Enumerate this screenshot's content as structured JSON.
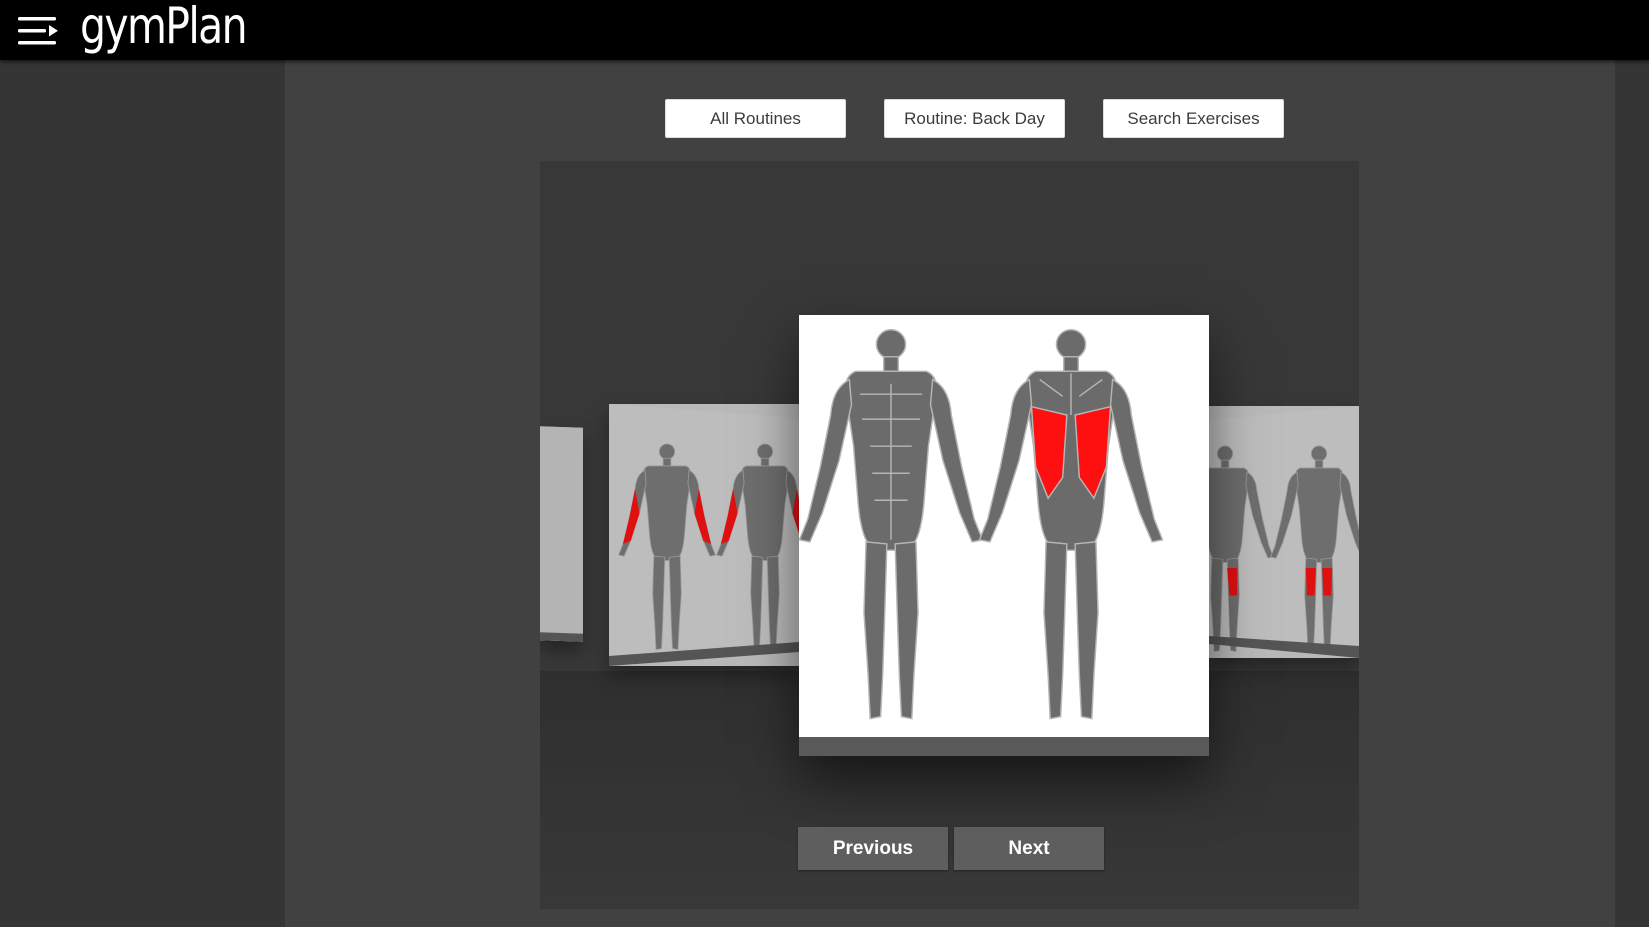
{
  "header": {
    "brand": "gymPlan",
    "menu_icon": "menu-hamburger-icon"
  },
  "toolbar": {
    "all_routines_label": "All Routines",
    "routine_label": "Routine: Back Day",
    "search_label": "Search Exercises"
  },
  "carousel": {
    "previous_label": "Previous",
    "next_label": "Next",
    "slides": [
      {
        "highlight": "back-left-edge"
      },
      {
        "highlight": "forearms"
      },
      {
        "highlight": "lats"
      },
      {
        "highlight": "hamstrings"
      }
    ],
    "active_index": 2
  },
  "colors": {
    "topbar": "#000000",
    "background": "#353535",
    "panel": "#414141",
    "stage": "#383838",
    "muscle": "#6b6b6b",
    "highlight": "#ff1010",
    "nav_button": "#5e5e5e"
  }
}
